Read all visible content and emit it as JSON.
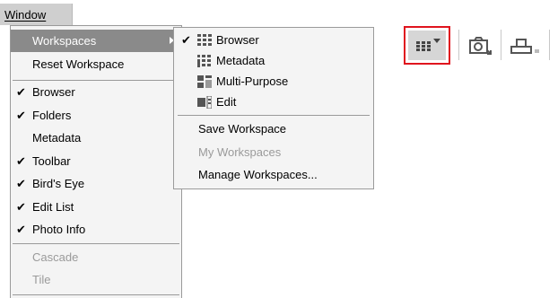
{
  "menubar": {
    "window": "Window"
  },
  "main_menu": {
    "workspaces": "Workspaces",
    "reset_workspace": "Reset Workspace",
    "browser": "Browser",
    "folders": "Folders",
    "metadata": "Metadata",
    "toolbar": "Toolbar",
    "birds_eye": "Bird's Eye",
    "edit_list": "Edit List",
    "photo_info": "Photo Info",
    "cascade": "Cascade",
    "tile": "Tile",
    "checkmark": "✔"
  },
  "sub_menu": {
    "browser": "Browser",
    "metadata": "Metadata",
    "multi_purpose": "Multi-Purpose",
    "edit": "Edit",
    "save_workspace": "Save Workspace",
    "my_workspaces": "My Workspaces",
    "manage_workspaces": "Manage Workspaces...",
    "checkmark": "✔"
  },
  "toolbar": {
    "icons": [
      "workspace-grid-icon",
      "camera-icon",
      "stamp-icon"
    ],
    "highlight_color": "#e0141e"
  }
}
